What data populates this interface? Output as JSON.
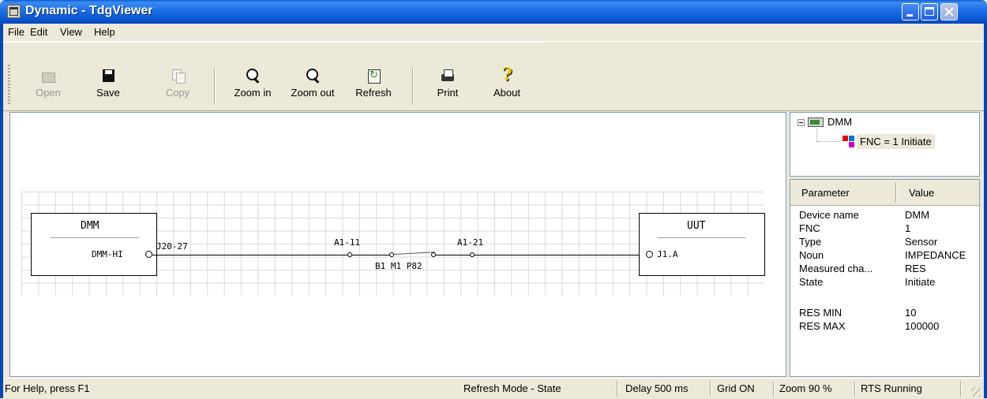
{
  "window": {
    "title": "Dynamic - TdgViewer"
  },
  "menu": [
    "File",
    "Edit",
    "View",
    "Help"
  ],
  "toolbar": {
    "open": "Open",
    "save": "Save",
    "copy": "Copy",
    "zoom_in": "Zoom in",
    "zoom_out": "Zoom out",
    "refresh": "Refresh",
    "print": "Print",
    "about": "About"
  },
  "diagram": {
    "left_box_title": "DMM",
    "left_pin": "DMM-HI",
    "left_connector": "J20-27",
    "switch_left_label": "A1-11",
    "switch_right_label": "A1-21",
    "switch_label": "B1 M1 P82",
    "right_box_title": "UUT",
    "right_pin": "J1.A"
  },
  "tree": {
    "root": "DMM",
    "child": "FNC = 1 Initiate"
  },
  "properties": {
    "header_param": "Parameter",
    "header_value": "Value",
    "rows": [
      {
        "k": "Device name",
        "v": "DMM"
      },
      {
        "k": "FNC",
        "v": "1"
      },
      {
        "k": "Type",
        "v": "Sensor"
      },
      {
        "k": "Noun",
        "v": "IMPEDANCE"
      },
      {
        "k": "Measured cha...",
        "v": "RES"
      },
      {
        "k": "State",
        "v": "Initiate"
      },
      {
        "k": "",
        "v": ""
      },
      {
        "k": "RES MIN",
        "v": "10"
      },
      {
        "k": "RES MAX",
        "v": "100000"
      }
    ]
  },
  "status": {
    "help": "For Help, press F1",
    "refresh_mode": "Refresh Mode - State",
    "delay": "Delay 500 ms",
    "grid": "Grid ON",
    "zoom": "Zoom 90 %",
    "rts": "RTS Running"
  },
  "colors": {
    "titlebar": "#0a58d2",
    "window_bg": "#ece9d8",
    "selection": "#ece9d8"
  }
}
